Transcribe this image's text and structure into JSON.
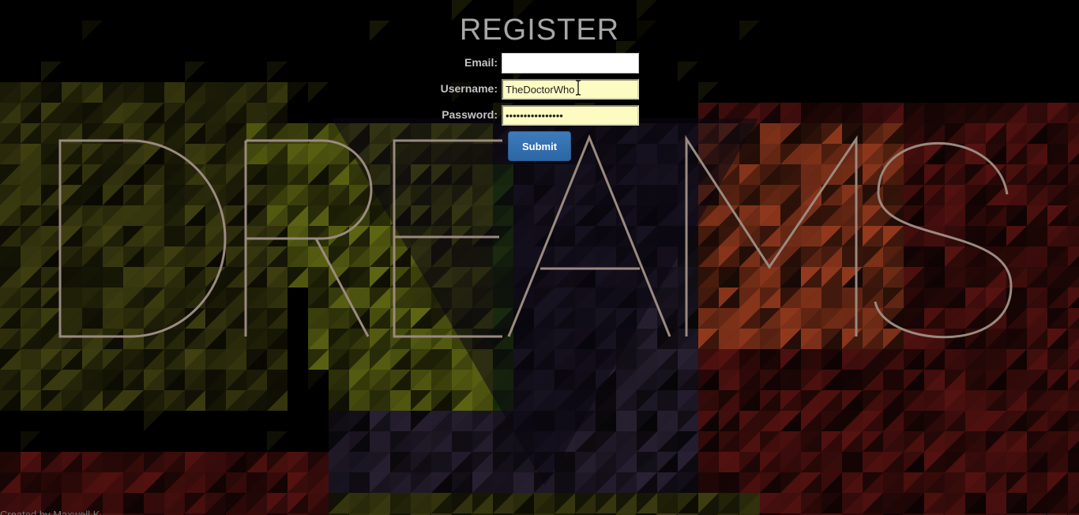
{
  "page": {
    "title": "REGISTER"
  },
  "form": {
    "email": {
      "label": "Email:",
      "value": ""
    },
    "username": {
      "label": "Username:",
      "value": "TheDoctorWho"
    },
    "password": {
      "label": "Password:",
      "value": "••••••••••••••••"
    },
    "submit_label": "Submit"
  },
  "background": {
    "word": "DREAMS",
    "word_color": "#9a8a80",
    "palette": {
      "yellow": "#8f9a1c",
      "green": "#3d7a12",
      "purple": "#3a2f4a",
      "orange": "#d6532a",
      "red": "#7a1a18",
      "olive": "#5a5a18",
      "black": "#000000"
    }
  },
  "footer": {
    "text": "Created by Maxwell K..."
  },
  "colors": {
    "accent_button": "#2c67a4",
    "autofill_field": "#fbfbc2"
  }
}
